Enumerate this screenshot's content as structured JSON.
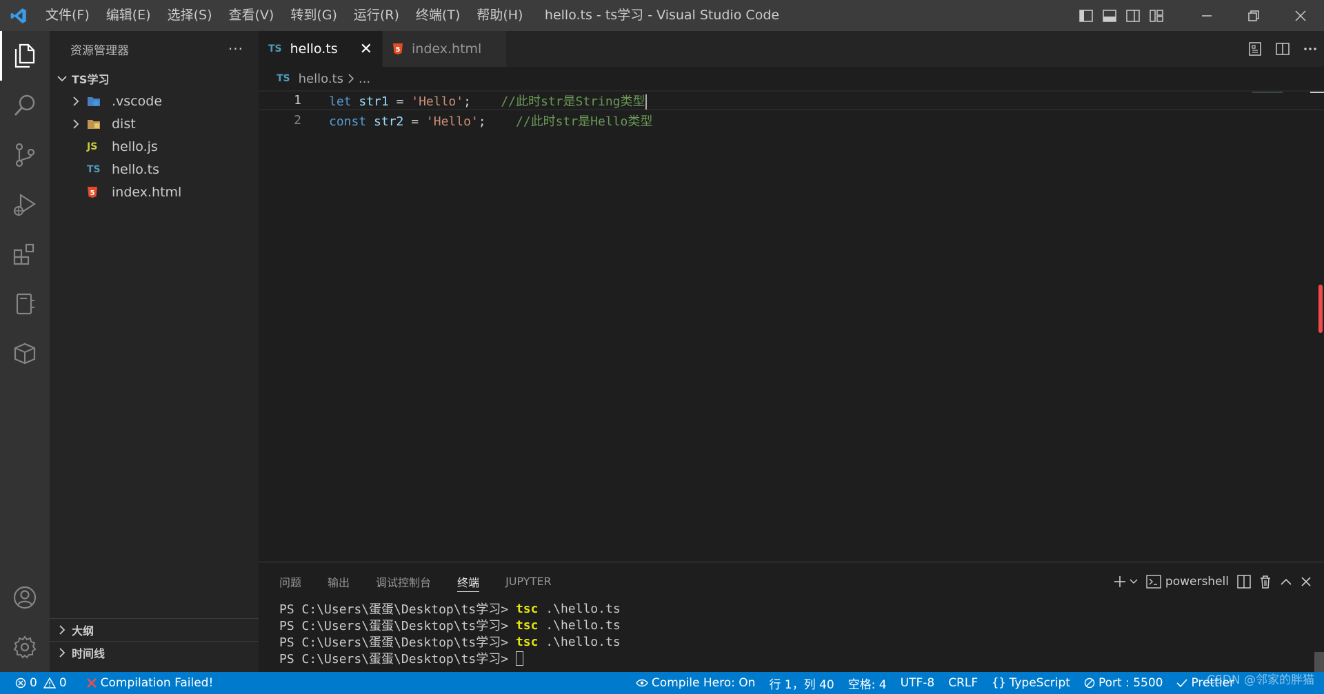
{
  "titlebar": {
    "menu": [
      "文件(F)",
      "编辑(E)",
      "选择(S)",
      "查看(V)",
      "转到(G)",
      "运行(R)",
      "终端(T)",
      "帮助(H)"
    ],
    "title": "hello.ts - ts学习 - Visual Studio Code"
  },
  "sidebar": {
    "header": "资源管理器",
    "more": "···",
    "folder": "TS学习",
    "items": [
      {
        "name": ".vscode",
        "kind": "folder"
      },
      {
        "name": "dist",
        "kind": "folder"
      },
      {
        "name": "hello.js",
        "badge": "JS"
      },
      {
        "name": "hello.ts",
        "badge": "TS"
      },
      {
        "name": "index.html",
        "badge": "5"
      }
    ],
    "outline": "大纲",
    "timeline": "时间线"
  },
  "tabs": [
    {
      "label": "hello.ts",
      "badge": "TS",
      "active": true,
      "close": "✕"
    },
    {
      "label": "index.html",
      "badge": "5",
      "active": false
    }
  ],
  "breadcrumb": {
    "badge": "TS",
    "file": "hello.ts",
    "rest": "..."
  },
  "editor": {
    "lines": [
      {
        "num": "1",
        "kw": "let",
        "name": "str1",
        "op": "=",
        "str": "'Hello'",
        "semi": ";",
        "comment": "//此时str是String类型"
      },
      {
        "num": "2",
        "kw": "const",
        "name": "str2",
        "op": "=",
        "str": "'Hello'",
        "semi": ";",
        "comment": "//此时str是Hello类型"
      }
    ]
  },
  "panel": {
    "tabs": [
      "问题",
      "输出",
      "调试控制台",
      "终端",
      "JUPYTER"
    ],
    "active_tab": "终端",
    "shell": "powershell",
    "terminal": [
      {
        "prompt": "PS C:\\Users\\蛋蛋\\Desktop\\ts学习> ",
        "cmd": "tsc",
        "arg": " .\\hello.ts"
      },
      {
        "prompt": "PS C:\\Users\\蛋蛋\\Desktop\\ts学习> ",
        "cmd": "tsc",
        "arg": " .\\hello.ts"
      },
      {
        "prompt": "PS C:\\Users\\蛋蛋\\Desktop\\ts学习> ",
        "cmd": "tsc",
        "arg": " .\\hello.ts"
      },
      {
        "prompt": "PS C:\\Users\\蛋蛋\\Desktop\\ts学习> ",
        "cmd": "",
        "arg": ""
      }
    ]
  },
  "statusbar": {
    "errors": "0",
    "warnings": "0",
    "compile": "Compilation Failed!",
    "compile_hero": "Compile Hero: On",
    "position": "行 1，列 40",
    "spaces": "空格: 4",
    "encoding": "UTF-8",
    "eol": "CRLF",
    "language": "TypeScript",
    "port": "Port : 5500",
    "prettier": "Prettier"
  },
  "watermark": "CSDN @邻家的胖猫",
  "colors": {
    "accent": "#007acc",
    "error": "#f14c4c",
    "ts": "#519aba",
    "js": "#cbcb41",
    "html": "#e44d26"
  }
}
